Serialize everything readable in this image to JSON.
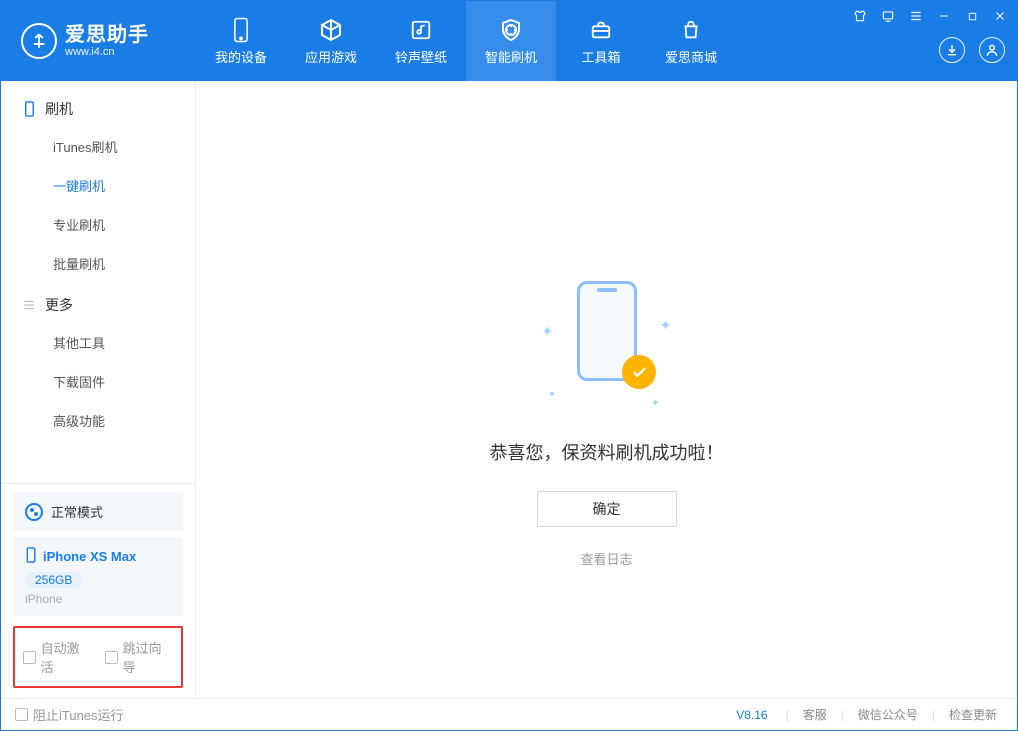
{
  "colors": {
    "brand": "#1a7de6",
    "accent": "#ffb400",
    "danger_border": "#e53935"
  },
  "app": {
    "name_cn": "爱思助手",
    "url": "www.i4.cn"
  },
  "win": {
    "shirt": "⇱",
    "skin": "◫",
    "menu": "≡",
    "min": "—",
    "max": "☐",
    "close": "✕"
  },
  "nav": {
    "items": [
      {
        "label": "我的设备",
        "icon": "device"
      },
      {
        "label": "应用游戏",
        "icon": "cube"
      },
      {
        "label": "铃声壁纸",
        "icon": "music"
      },
      {
        "label": "智能刷机",
        "icon": "shield",
        "active": true
      },
      {
        "label": "工具箱",
        "icon": "toolbox"
      },
      {
        "label": "爱思商城",
        "icon": "shop"
      }
    ],
    "download_icon": "↓",
    "user_icon": "user"
  },
  "sidebar": {
    "section1": {
      "title": "刷机",
      "icon": "phone"
    },
    "items1": [
      "iTunes刷机",
      "一键刷机",
      "专业刷机",
      "批量刷机"
    ],
    "active1": 1,
    "section2": {
      "title": "更多",
      "icon": "list"
    },
    "items2": [
      "其他工具",
      "下载固件",
      "高级功能"
    ],
    "mode": {
      "label": "正常模式"
    },
    "device": {
      "name": "iPhone XS Max",
      "storage": "256GB",
      "sub": "iPhone"
    },
    "opts": {
      "auto_activate": "自动激活",
      "skip_guide": "跳过向导"
    }
  },
  "main": {
    "message": "恭喜您，保资料刷机成功啦！",
    "confirm": "确定",
    "log_link": "查看日志"
  },
  "footer": {
    "block_itunes": "阻止iTunes运行",
    "version": "V8.16",
    "links": [
      "客服",
      "微信公众号",
      "检查更新"
    ]
  }
}
